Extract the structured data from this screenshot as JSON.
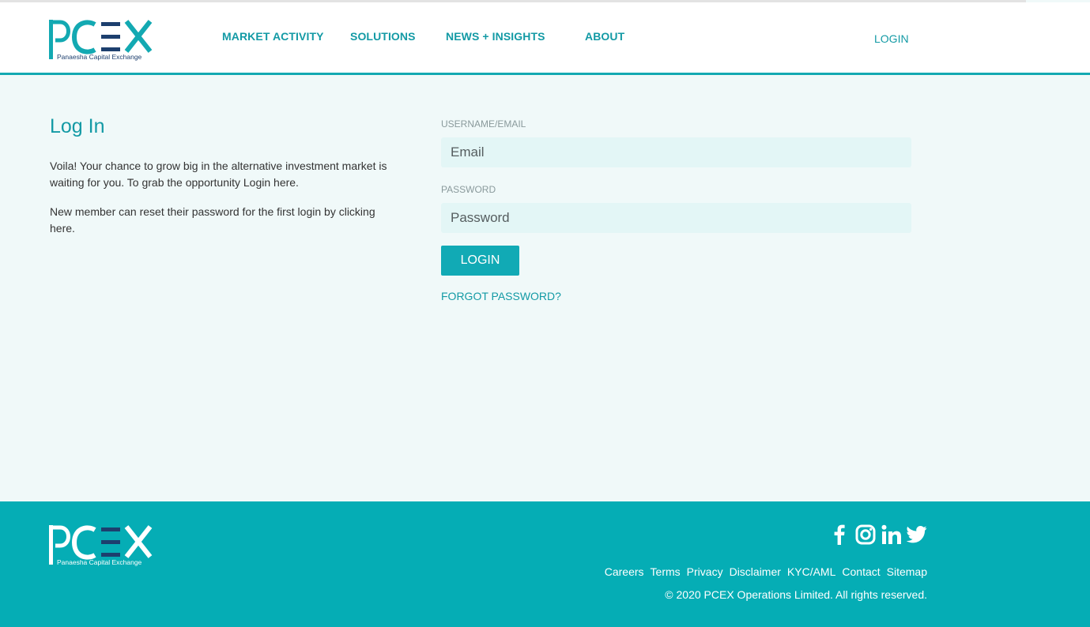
{
  "colors": {
    "brand": "#13a9b2",
    "brand_dark": "#1d3f6e",
    "page_bg": "#f0f9f9",
    "footer_bg": "#05adb5",
    "field_bg": "#e3f6f6"
  },
  "brand": {
    "name": "PCEX",
    "tagline": "Panaesha Capital Exchange"
  },
  "nav": {
    "items": [
      {
        "label": "MARKET ACTIVITY"
      },
      {
        "label": "SOLUTIONS"
      },
      {
        "label": "NEWS + INSIGHTS"
      },
      {
        "label": "ABOUT"
      }
    ],
    "login": "LOGIN"
  },
  "main": {
    "title": "Log In",
    "intro1": "Voila! Your chance to grow big in the alternative investment market is waiting for you. To grab the opportunity Login here.",
    "intro2": "New member can reset their password for the first login by clicking here."
  },
  "form": {
    "username_label": "USERNAME/EMAIL",
    "username_placeholder": "Email",
    "password_label": "PASSWORD",
    "password_placeholder": "Password",
    "submit_label": "LOGIN",
    "forgot_label": "FORGOT PASSWORD?"
  },
  "footer": {
    "social": [
      "facebook-icon",
      "instagram-icon",
      "linkedin-icon",
      "twitter-icon"
    ],
    "links": [
      "Careers",
      "Terms",
      "Privacy",
      "Disclaimer",
      "KYC/AML",
      "Contact",
      "Sitemap"
    ],
    "copyright": "© 2020 PCEX Operations Limited. All rights reserved."
  }
}
